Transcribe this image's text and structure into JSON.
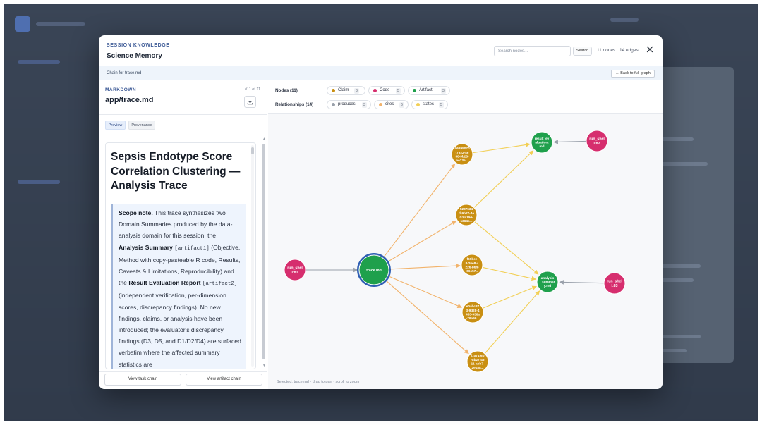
{
  "modal": {
    "kicker": "SESSION KNOWLEDGE",
    "title": "Science Memory",
    "search_placeholder": "Search nodes...",
    "search_button": "Search",
    "node_count": "11 nodes",
    "edge_count": "14 edges"
  },
  "chain_bar": {
    "label": "Chain for trace.md",
    "back_button": "← Back to full graph"
  },
  "left_panel": {
    "kicker": "MARKDOWN",
    "file_name": "app/trace.md",
    "page_indicator": "#11 of 11",
    "tabs": {
      "preview": "Preview",
      "provenance": "Provenance"
    },
    "document": {
      "title": "Sepsis Endotype Score Correlation Clustering — Analysis Trace",
      "scope_label": "Scope note.",
      "scope_text_1": " This trace synthesizes two Domain Summaries produced by the data-analysis domain for this session: the ",
      "scope_bold_1": "Analysis Summary",
      "scope_code_1": "[artifact1]",
      "scope_text_2": " (Objective, Method with copy-pasteable R code, Results, Caveats & Limitations, Reproducibility) and the ",
      "scope_bold_2": "Result Evaluation Report",
      "scope_code_2": "[artifact2]",
      "scope_text_3": " (independent verification, per-dimension scores, discrepancy findings). No new findings, claims, or analysis have been introduced; the evaluator's discrepancy findings (D3, D5, and D1/D2/D4) are surfaced verbatim where the affected summary statistics are"
    },
    "footer": {
      "task_chain": "View task chain",
      "artifact_chain": "View artifact chain"
    }
  },
  "legend": {
    "nodes_label": "Nodes (11)",
    "relationships_label": "Relationships (14)",
    "node_types": [
      {
        "label": "Claim",
        "count": "3",
        "color": "#c98f12"
      },
      {
        "label": "Code",
        "count": "5",
        "color": "#d62e6e"
      },
      {
        "label": "Artifact",
        "count": "3",
        "color": "#1fa04c"
      }
    ],
    "relationship_types": [
      {
        "label": "produces",
        "count": "3",
        "color": "#9aa1ab"
      },
      {
        "label": "cites",
        "count": "6",
        "color": "#f2b36b"
      },
      {
        "label": "states",
        "count": "5",
        "color": "#f2cf55"
      }
    ]
  },
  "graph": {
    "hint": "Selected: trace.md · drag to pan · scroll to zoom",
    "colors": {
      "claim": "#c98f12",
      "code": "#d62e6e",
      "artifact": "#1fa04c",
      "selected_ring": "#2f5fb3",
      "produces": "#9aa1ab",
      "cites": "#f2b36b",
      "states": "#f2cf55"
    },
    "nodes": [
      {
        "id": "trace",
        "type": "artifact",
        "lines": [
          "trace.md"
        ]
      },
      {
        "id": "result",
        "type": "artifact",
        "lines": [
          "result_ev",
          "aluation.",
          "md"
        ]
      },
      {
        "id": "analysis",
        "type": "artifact",
        "lines": [
          "analysis",
          "_summar",
          "y.md"
        ]
      },
      {
        "id": "run1",
        "type": "code",
        "lines": [
          "run_shel",
          "l:81"
        ]
      },
      {
        "id": "run2",
        "type": "code",
        "lines": [
          "run_shel",
          "l:82"
        ]
      },
      {
        "id": "run3",
        "type": "code",
        "lines": [
          "run_shel",
          "l:83"
        ]
      },
      {
        "id": "c1",
        "type": "claim",
        "lines": [
          "b6895070",
          "-7922-46",
          "38-9b28-",
          "ae13e..."
        ]
      },
      {
        "id": "c2",
        "type": "claim",
        "lines": [
          "5287634",
          "d-9b27-4e",
          "d3-9194-",
          "1364c..."
        ]
      },
      {
        "id": "c3",
        "type": "claim",
        "lines": [
          "f69bee",
          "8-26e8-4",
          "226-b6f8",
          "-66c57..."
        ]
      },
      {
        "id": "c4",
        "type": "claim",
        "lines": [
          "e0abc37",
          "3-9d28-4",
          "433-936a",
          "-79a99..."
        ]
      },
      {
        "id": "c5",
        "type": "claim",
        "lines": [
          "f1074f6b",
          "-8b27-46",
          "11-aeb7-",
          "2e188..."
        ]
      }
    ],
    "edges": [
      {
        "from": "run1",
        "to": "trace",
        "rel": "produces"
      },
      {
        "from": "run2",
        "to": "result",
        "rel": "produces"
      },
      {
        "from": "run3",
        "to": "analysis",
        "rel": "produces"
      },
      {
        "from": "trace",
        "to": "c1",
        "rel": "cites"
      },
      {
        "from": "trace",
        "to": "c2",
        "rel": "cites"
      },
      {
        "from": "trace",
        "to": "c3",
        "rel": "cites"
      },
      {
        "from": "trace",
        "to": "c4",
        "rel": "cites"
      },
      {
        "from": "trace",
        "to": "c5",
        "rel": "cites"
      },
      {
        "from": "c1",
        "to": "result",
        "rel": "states"
      },
      {
        "from": "c2",
        "to": "result",
        "rel": "states"
      },
      {
        "from": "c2",
        "to": "analysis",
        "rel": "states"
      },
      {
        "from": "c3",
        "to": "analysis",
        "rel": "states"
      },
      {
        "from": "c4",
        "to": "analysis",
        "rel": "states"
      },
      {
        "from": "c5",
        "to": "analysis",
        "rel": "states"
      }
    ]
  }
}
